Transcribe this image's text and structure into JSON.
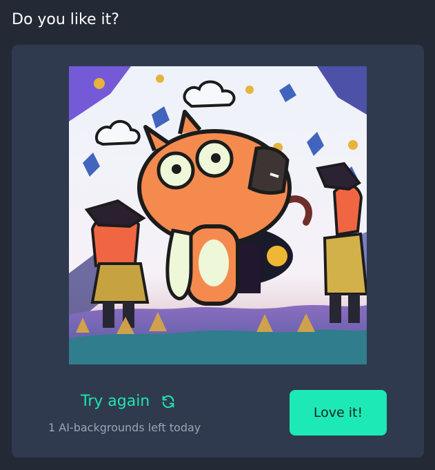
{
  "header": {
    "title": "Do you like it?"
  },
  "preview": {
    "icon": "generated-image",
    "colors": {
      "accent": "#1de9b6",
      "card": "#2f3a4f",
      "background": "#232a36"
    }
  },
  "actions": {
    "try_again_label": "Try again",
    "refresh_icon": "refresh-icon",
    "remaining_text": "1 AI-backgrounds left today",
    "love_label": "Love it!"
  }
}
